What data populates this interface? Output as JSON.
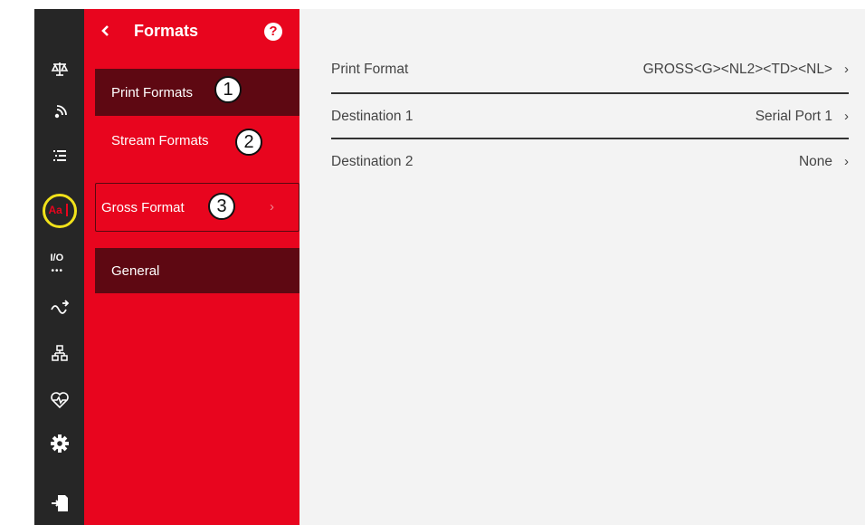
{
  "panel": {
    "title": "Formats",
    "back_icon": "chevron-left-icon",
    "help_label": "?"
  },
  "menu": [
    {
      "label": "Print Formats",
      "badge": "1",
      "state": "selected"
    },
    {
      "label": "Stream Formats",
      "badge": "2",
      "state": "normal"
    },
    {
      "label": "Gross Format",
      "badge": "3",
      "state": "outlined"
    },
    {
      "label": "General",
      "state": "section"
    }
  ],
  "rail_icons": [
    "scale-icon",
    "wireless-icon",
    "list-icon",
    "formats-aa-icon",
    "io-icon",
    "signal-icon",
    "network-icon",
    "heart-health-icon",
    "gear-icon",
    "export-icon"
  ],
  "rail_active_text": "Aa",
  "rail_io_text": "I/O",
  "content": {
    "rows": [
      {
        "name": "Print Format",
        "value": "GROSS<G><NL2><TD><NL>",
        "chevron": "›"
      },
      {
        "name": "Destination 1",
        "value": "Serial Port 1",
        "chevron": "›"
      },
      {
        "name": "Destination 2",
        "value": "None",
        "chevron": "›"
      }
    ]
  },
  "colors": {
    "rail": "#262626",
    "panel": "#e8051e",
    "selected_item": "#5e0812",
    "content_bg": "#f3f3f3",
    "highlight_ring": "#f2e21a"
  }
}
